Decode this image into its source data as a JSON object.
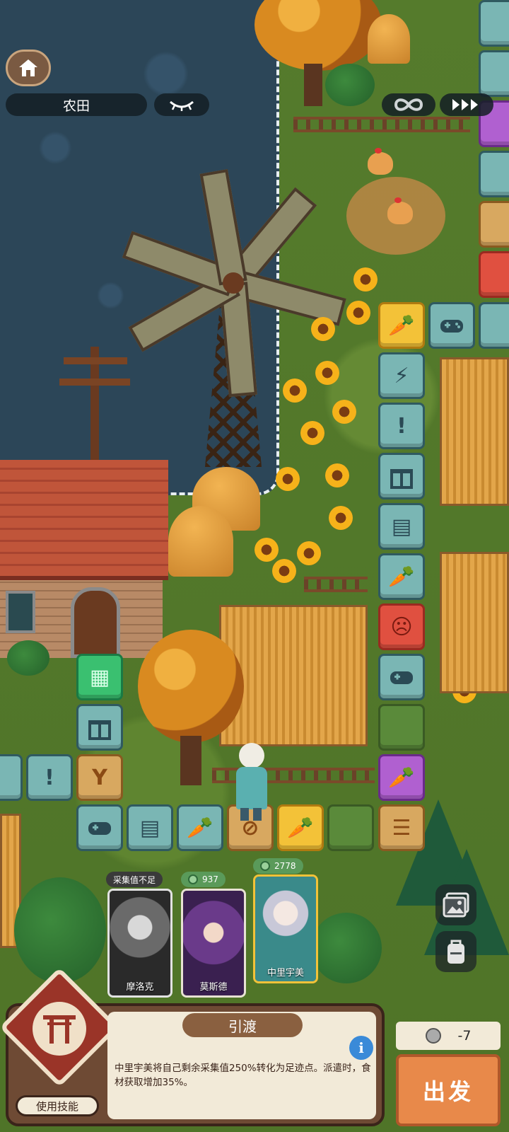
{
  "hud": {
    "location_label": "农田",
    "home_icon": "home-icon",
    "eye_icon": "eye-closed-icon",
    "loop_icon": "infinity-icon",
    "speed_icon": "fast-forward-icon"
  },
  "side_buttons": [
    "gallery-icon",
    "backpack-icon"
  ],
  "characters": [
    {
      "name": "摩洛克",
      "tag": "采集值不足",
      "grayscale": true
    },
    {
      "name": "莫斯德",
      "tag": "937",
      "grayscale": false
    },
    {
      "name": "中里宇美",
      "tag": "2778",
      "grayscale": false,
      "selected": true
    }
  ],
  "skill": {
    "use_label": "使用技能",
    "title": "引渡",
    "description": "中里宇美将自己剩余采集值250%转化为足迹点。派遣时，食材获取增加35%。",
    "info_label": "i"
  },
  "dispatch": {
    "cost": "-7",
    "go_label": "出发"
  },
  "colors": {
    "accent": "#e8894a",
    "panel": "#6e4a34",
    "tile_teal": "#7ab6b4"
  }
}
